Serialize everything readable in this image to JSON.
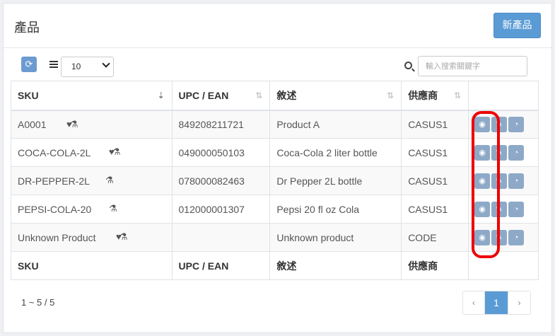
{
  "header": {
    "title": "產品",
    "new_button": "新產品"
  },
  "toolbar": {
    "page_size": "10",
    "search_placeholder": "輸入搜索關鍵字"
  },
  "table": {
    "columns": [
      "SKU",
      "UPC / EAN",
      "敘述",
      "供應商"
    ],
    "rows": [
      {
        "sku": "A0001",
        "badges": "♥⚗",
        "upc": "849208211721",
        "desc": "Product A",
        "supplier": "CASUS1"
      },
      {
        "sku": "COCA-COLA-2L",
        "badges": "♥⚗",
        "upc": "049000050103",
        "desc": "Coca-Cola 2 liter bottle",
        "supplier": "CASUS1"
      },
      {
        "sku": "DR-PEPPER-2L",
        "badges": "⚗",
        "upc": "078000082463",
        "desc": "Dr Pepper 2L bottle",
        "supplier": "CASUS1"
      },
      {
        "sku": "PEPSI-COLA-20",
        "badges": "⚗",
        "upc": "012000001307",
        "desc": "Pepsi 20 fl oz Cola",
        "supplier": "CASUS1"
      },
      {
        "sku": "Unknown Product",
        "badges": "♥⚗",
        "upc": "",
        "desc": "Unknown product",
        "supplier": "CODE"
      }
    ]
  },
  "footer": {
    "range": "1 ~ 5 / 5",
    "prev": "‹",
    "page": "1",
    "next": "›"
  },
  "icons": {
    "refresh": "refresh-icon",
    "list": "list-icon",
    "search": "search-icon",
    "view": "eye-icon",
    "edit": "edit-icon",
    "chart": "pie-chart-icon"
  },
  "colors": {
    "primary": "#5b9bd5",
    "action": "#8ea9c7",
    "highlight": "#e00000"
  }
}
